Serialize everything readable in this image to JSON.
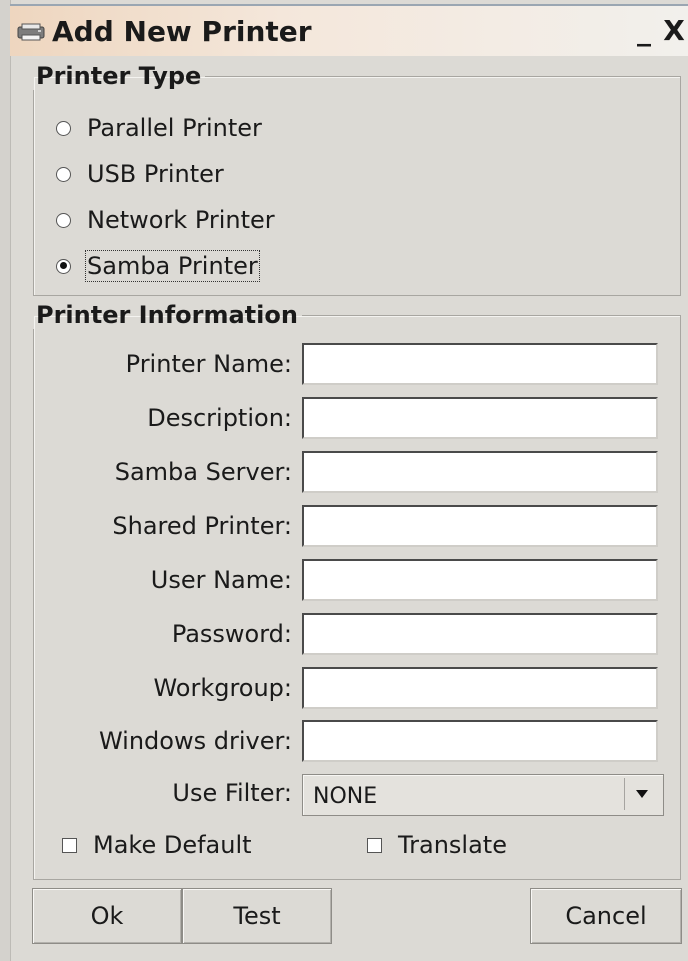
{
  "window": {
    "title": "Add New Printer",
    "minimize_label": "_",
    "close_label": "X"
  },
  "printer_type": {
    "legend": "Printer Type",
    "options": [
      {
        "label": "Parallel Printer",
        "checked": false
      },
      {
        "label": "USB Printer",
        "checked": false
      },
      {
        "label": "Network Printer",
        "checked": false
      },
      {
        "label": "Samba Printer",
        "checked": true
      }
    ]
  },
  "printer_info": {
    "legend": "Printer Information",
    "fields": [
      {
        "label": "Printer Name:",
        "value": ""
      },
      {
        "label": "Description:",
        "value": ""
      },
      {
        "label": "Samba Server:",
        "value": ""
      },
      {
        "label": "Shared Printer:",
        "value": ""
      },
      {
        "label": "User Name:",
        "value": ""
      },
      {
        "label": "Password:",
        "value": ""
      },
      {
        "label": "Workgroup:",
        "value": ""
      },
      {
        "label": "Windows driver:",
        "value": ""
      }
    ],
    "filter": {
      "label": "Use Filter:",
      "value": "NONE"
    },
    "make_default": {
      "label": "Make Default",
      "checked": false
    },
    "translate": {
      "label": "Translate",
      "checked": false
    }
  },
  "buttons": {
    "ok": "Ok",
    "test": "Test",
    "cancel": "Cancel"
  },
  "icons": {
    "window_icon": "printer-icon",
    "dropdown": "chevron-down-icon"
  }
}
